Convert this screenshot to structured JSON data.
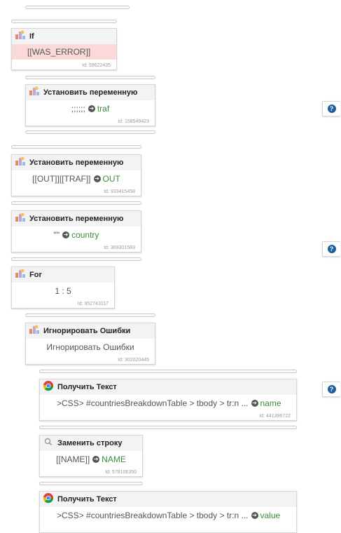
{
  "blocks": [
    {
      "title": "If",
      "body": "[[WAS_ERROR]]",
      "id": "Id: 59622435"
    },
    {
      "title": "Установить переменную",
      "body": ";;;;;;",
      "var": "traf",
      "id": "Id: 158549423"
    },
    {
      "title": "Установить переменную",
      "body": "[[OUT]][[TRAF]]",
      "var": "OUT",
      "id": "Id: 933415458"
    },
    {
      "title": "Установить переменную",
      "body": "\"\"",
      "var": "country",
      "id": "Id: 369301583"
    },
    {
      "title": "For",
      "body": "1 : 5",
      "id": "Id: 952743117"
    },
    {
      "title": "Игнорировать Ошибки",
      "body": "Игнорировать Ошибки",
      "id": "Id: 302020445"
    },
    {
      "title": "Получить Текст",
      "body": ">CSS> #countriesBreakdownTable > tbody > tr:n ...",
      "var": "name",
      "id": "Id: 441396722"
    },
    {
      "title": "Заменить строку",
      "body": "[[NAME]]",
      "var": "NAME",
      "id": "Id: 578106350"
    },
    {
      "title": "Получить Текст",
      "body": ">CSS> #countriesBreakdownTable > tbody > tr:n ...",
      "var": "value"
    }
  ],
  "help": {
    "label": "?"
  },
  "icons": {
    "block": "variable-block-icon",
    "chrome": "chrome-icon",
    "search": "search-icon",
    "arrow": "arrow-right-circle-icon",
    "help": "help-icon"
  }
}
